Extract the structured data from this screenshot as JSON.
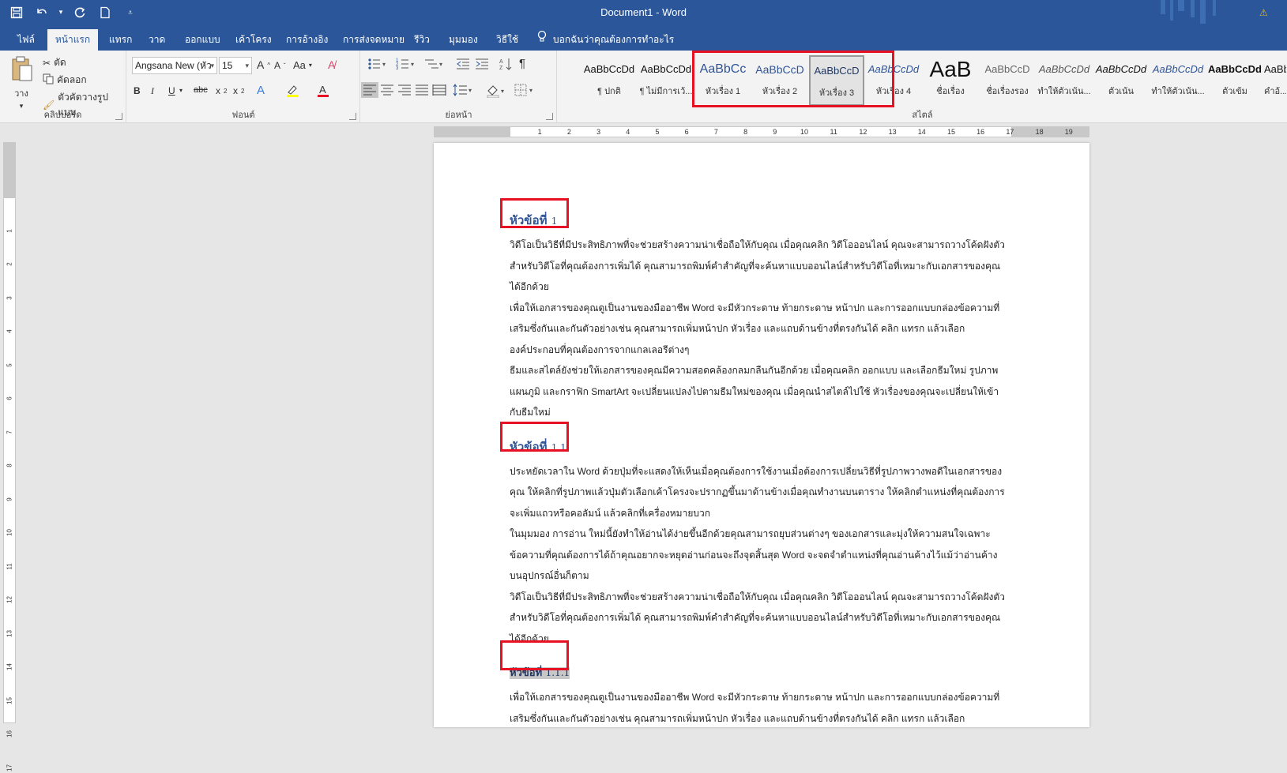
{
  "window": {
    "title": "Document1  -  Word"
  },
  "qat": {
    "save": "save-icon",
    "undo": "undo-icon",
    "redo": "redo-icon",
    "new": "new-doc-icon"
  },
  "tabs": [
    {
      "label": "ไฟล์"
    },
    {
      "label": "หน้าแรก"
    },
    {
      "label": "แทรก"
    },
    {
      "label": "วาด"
    },
    {
      "label": "ออกแบบ"
    },
    {
      "label": "เค้าโครง"
    },
    {
      "label": "การอ้างอิง"
    },
    {
      "label": "การส่งจดหมาย"
    },
    {
      "label": "รีวิว"
    },
    {
      "label": "มุมมอง"
    },
    {
      "label": "วิธีใช้"
    }
  ],
  "tell_me": "บอกฉันว่าคุณต้องการทำอะไร",
  "clipboard": {
    "paste": "วาง",
    "cut": "ตัด",
    "copy": "คัดลอก",
    "format_painter": "ตัวคัดวางรูปแบบ",
    "label": "คลิปบอร์ด"
  },
  "font": {
    "name": "Angsana New (หัว",
    "size": "15",
    "case_label": "Aa",
    "label": "ฟอนต์"
  },
  "paragraph": {
    "label": "ย่อหน้า"
  },
  "styles": {
    "label": "สไตล์",
    "items": [
      {
        "preview": "AaBbCcDd",
        "name": "¶ ปกติ"
      },
      {
        "preview": "AaBbCcDd",
        "name": "¶ ไม่มีการเว้..."
      },
      {
        "preview": "AaBbCc",
        "name": "หัวเรื่อง 1"
      },
      {
        "preview": "AaBbCcD",
        "name": "หัวเรื่อง 2"
      },
      {
        "preview": "AaBbCcD",
        "name": "หัวเรื่อง 3"
      },
      {
        "preview": "AaBbCcDd",
        "name": "หัวเรื่อง 4"
      },
      {
        "preview": "AaB",
        "name": "ชื่อเรื่อง"
      },
      {
        "preview": "AaBbCcD",
        "name": "ชื่อเรื่องรอง"
      },
      {
        "preview": "AaBbCcDd",
        "name": "ทำให้ตัวเน้น..."
      },
      {
        "preview": "AaBbCcDd",
        "name": "ตัวเน้น"
      },
      {
        "preview": "AaBbCcDd",
        "name": "ทำให้ตัวเน้น..."
      },
      {
        "preview": "AaBbCcDd",
        "name": "ตัวเข้ม"
      },
      {
        "preview": "AaBbCcDd",
        "name": "คำอ้..."
      }
    ]
  },
  "ruler": {
    "marks": [
      "1",
      "2",
      "3",
      "4",
      "5",
      "6",
      "7",
      "8",
      "9",
      "10",
      "11",
      "12",
      "13",
      "14",
      "15",
      "16",
      "17",
      "18",
      "19"
    ]
  },
  "vruler": {
    "marks": [
      "1",
      "2",
      "3",
      "4",
      "5",
      "6",
      "7",
      "8",
      "9",
      "10",
      "11",
      "12",
      "13",
      "14",
      "15",
      "16",
      "17"
    ]
  },
  "document": {
    "h1": {
      "text": "หัวข้อที่ ",
      "num": "1"
    },
    "p1": [
      "วิดีโอเป็นวิธีที่มีประสิทธิภาพที่จะช่วยสร้างความน่าเชื่อถือให้กับคุณ เมื่อคุณคลิก วิดีโอออนไลน์ คุณจะสามารถวางโค้ดฝังตัว",
      "สำหรับวิดีโอที่คุณต้องการเพิ่มได้ คุณสามารถพิมพ์คำสำคัญที่จะค้นหาแบบออนไลน์สำหรับวิดีโอที่เหมาะกับเอกสารของคุณ",
      "ได้อีกด้วย",
      "เพื่อให้เอกสารของคุณดูเป็นงานของมืออาชีพ Word จะมีหัวกระดาษ ท้ายกระดาษ หน้าปก และการออกแบบกล่องข้อความที่",
      "เสริมซึ่งกันและกันตัวอย่างเช่น คุณสามารถเพิ่มหน้าปก หัวเรื่อง และแถบด้านข้างที่ตรงกันได้ คลิก แทรก แล้วเลือก",
      "องค์ประกอบที่คุณต้องการจากแกลเลอรีต่างๆ",
      "ธีมและสไตล์ยังช่วยให้เอกสารของคุณมีความสอดคล้องกลมกลืนกันอีกด้วย เมื่อคุณคลิก ออกแบบ และเลือกธีมใหม่ รูปภาพ",
      "แผนภูมิ และกราฟิก SmartArt จะเปลี่ยนแปลงไปตามธีมใหม่ของคุณ เมื่อคุณนำสไตล์ไปใช้ หัวเรื่องของคุณจะเปลี่ยนให้เข้า",
      "กับธีมใหม่"
    ],
    "h2": {
      "text": "หัวข้อที่ ",
      "num": "1.1"
    },
    "p2": [
      "ประหยัดเวลาใน Word ด้วยปุ่มที่จะแสดงให้เห็นเมื่อคุณต้องการใช้งานเมื่อต้องการเปลี่ยนวิธีที่รูปภาพวางพอดีในเอกสารของ",
      "คุณ ให้คลิกที่รูปภาพแล้วปุ่มตัวเลือกเค้าโครงจะปรากฏขึ้นมาด้านข้างเมื่อคุณทำงานบนตาราง ให้คลิกตำแหน่งที่คุณต้องการ",
      "จะเพิ่มแถวหรือคอลัมน์ แล้วคลิกที่เครื่องหมายบวก",
      "ในมุมมอง การอ่าน ใหม่นี้ยังทำให้อ่านได้ง่ายขึ้นอีกด้วยคุณสามารถยุบส่วนต่างๆ ของเอกสารและมุ่งให้ความสนใจเฉพาะ",
      "ข้อความที่คุณต้องการได้ถ้าคุณอยากจะหยุดอ่านก่อนจะถึงจุดสิ้นสุด Word จะจดจำตำแหน่งที่คุณอ่านค้างไว้แม้ว่าอ่านค้าง",
      "บนอุปกรณ์อื่นก็ตาม",
      "วิดีโอเป็นวิธีที่มีประสิทธิภาพที่จะช่วยสร้างความน่าเชื่อถือให้กับคุณ เมื่อคุณคลิก วิดีโอออนไลน์ คุณจะสามารถวางโค้ดฝังตัว",
      "สำหรับวิดีโอที่คุณต้องการเพิ่มได้ คุณสามารถพิมพ์คำสำคัญที่จะค้นหาแบบออนไลน์สำหรับวิดีโอที่เหมาะกับเอกสารของคุณ",
      "ได้อีกด้วย"
    ],
    "h3": {
      "text": "หัวข้อที่ ",
      "num": "1.1.1"
    },
    "p3": [
      "เพื่อให้เอกสารของคุณดูเป็นงานของมืออาชีพ Word จะมีหัวกระดาษ ท้ายกระดาษ หน้าปก และการออกแบบกล่องข้อความที่",
      "เสริมซึ่งกันและกันตัวอย่างเช่น คุณสามารถเพิ่มหน้าปก หัวเรื่อง และแถบด้านข้างที่ตรงกันได้ คลิก แทรก แล้วเลือก"
    ]
  },
  "colors": {
    "accent": "#2b579a",
    "heading": "#2f5496",
    "highlight_box": "#e81123"
  }
}
